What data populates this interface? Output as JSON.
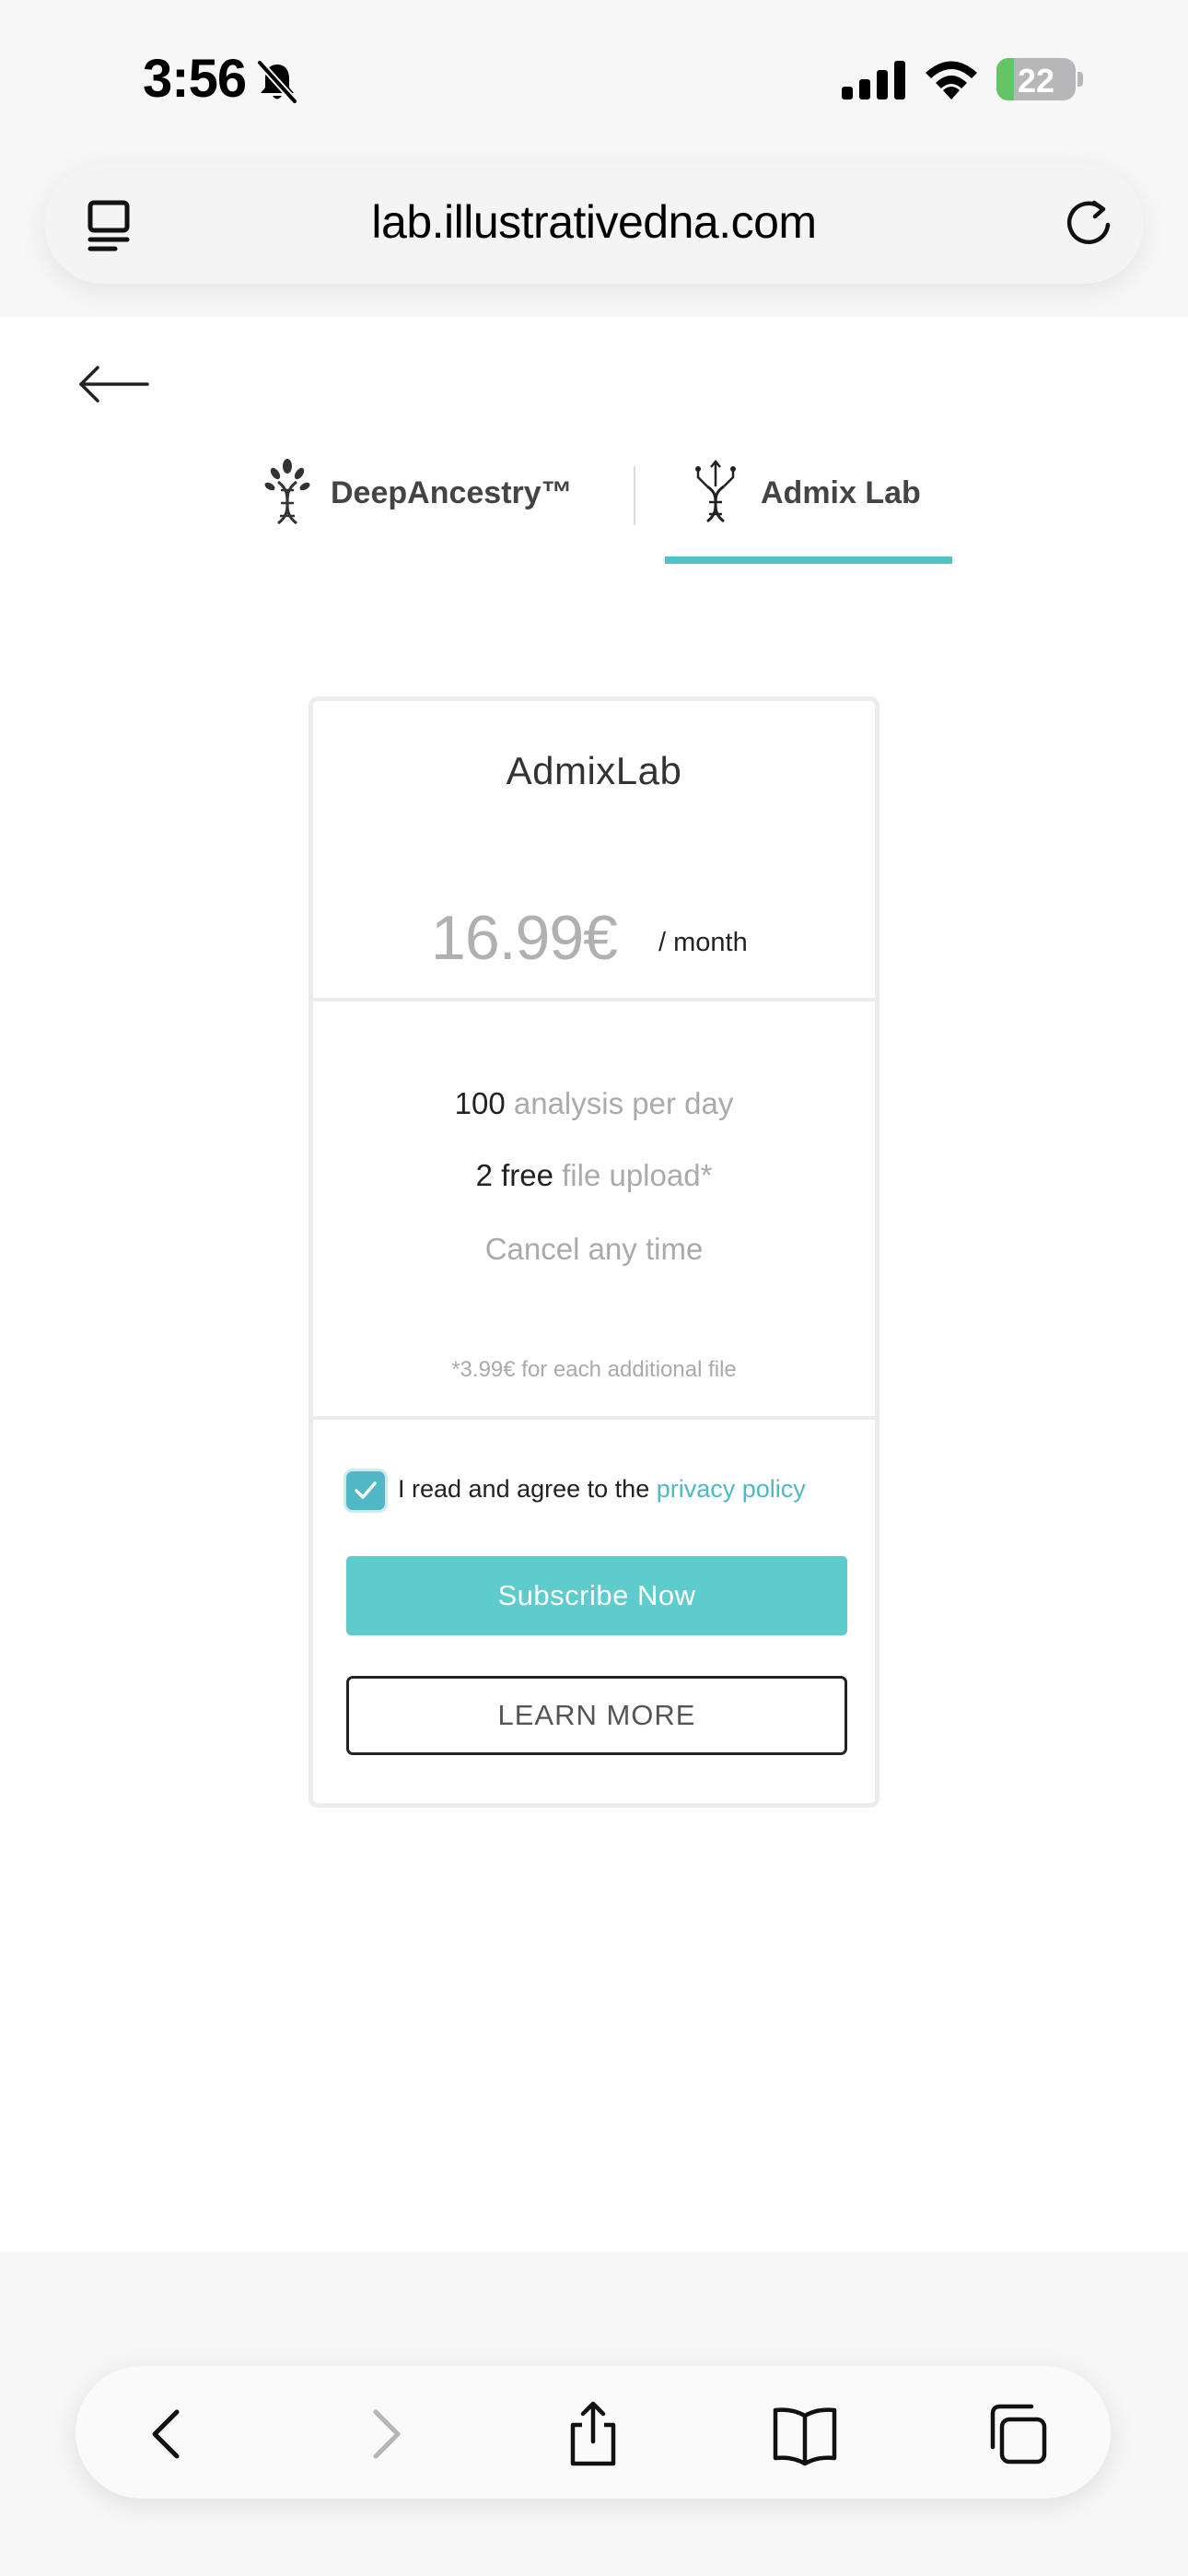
{
  "status_bar": {
    "time": "3:56",
    "battery_level": "22",
    "battery_fraction": 0.22
  },
  "browser": {
    "url": "lab.illustrativedna.com"
  },
  "nav_tabs": [
    {
      "label": "DeepAncestry™",
      "active": false
    },
    {
      "label": "Admix Lab",
      "active": true
    }
  ],
  "plan": {
    "name": "AdmixLab",
    "price": "16.99€",
    "period": "/ month",
    "features": [
      {
        "highlight": "100",
        "rest": " analysis per day"
      },
      {
        "highlight": "2 free",
        "rest": " file upload*"
      },
      {
        "highlight": "",
        "rest": "Cancel any time"
      }
    ],
    "footnote": "*3.99€ for each additional file",
    "agree_text": "I read and agree to the ",
    "agree_link": "privacy policy",
    "agree_checked": true,
    "subscribe_label": "Subscribe Now",
    "learn_more_label": "LEARN MORE"
  },
  "colors": {
    "accent": "#5ecbcd",
    "tab_underline": "#4fc1c8",
    "checkbox": "#4fb8c4",
    "battery_green": "#65c466"
  },
  "toolbar": {
    "icons": [
      "back-icon",
      "forward-icon",
      "share-icon",
      "bookmarks-icon",
      "tabs-icon"
    ]
  }
}
